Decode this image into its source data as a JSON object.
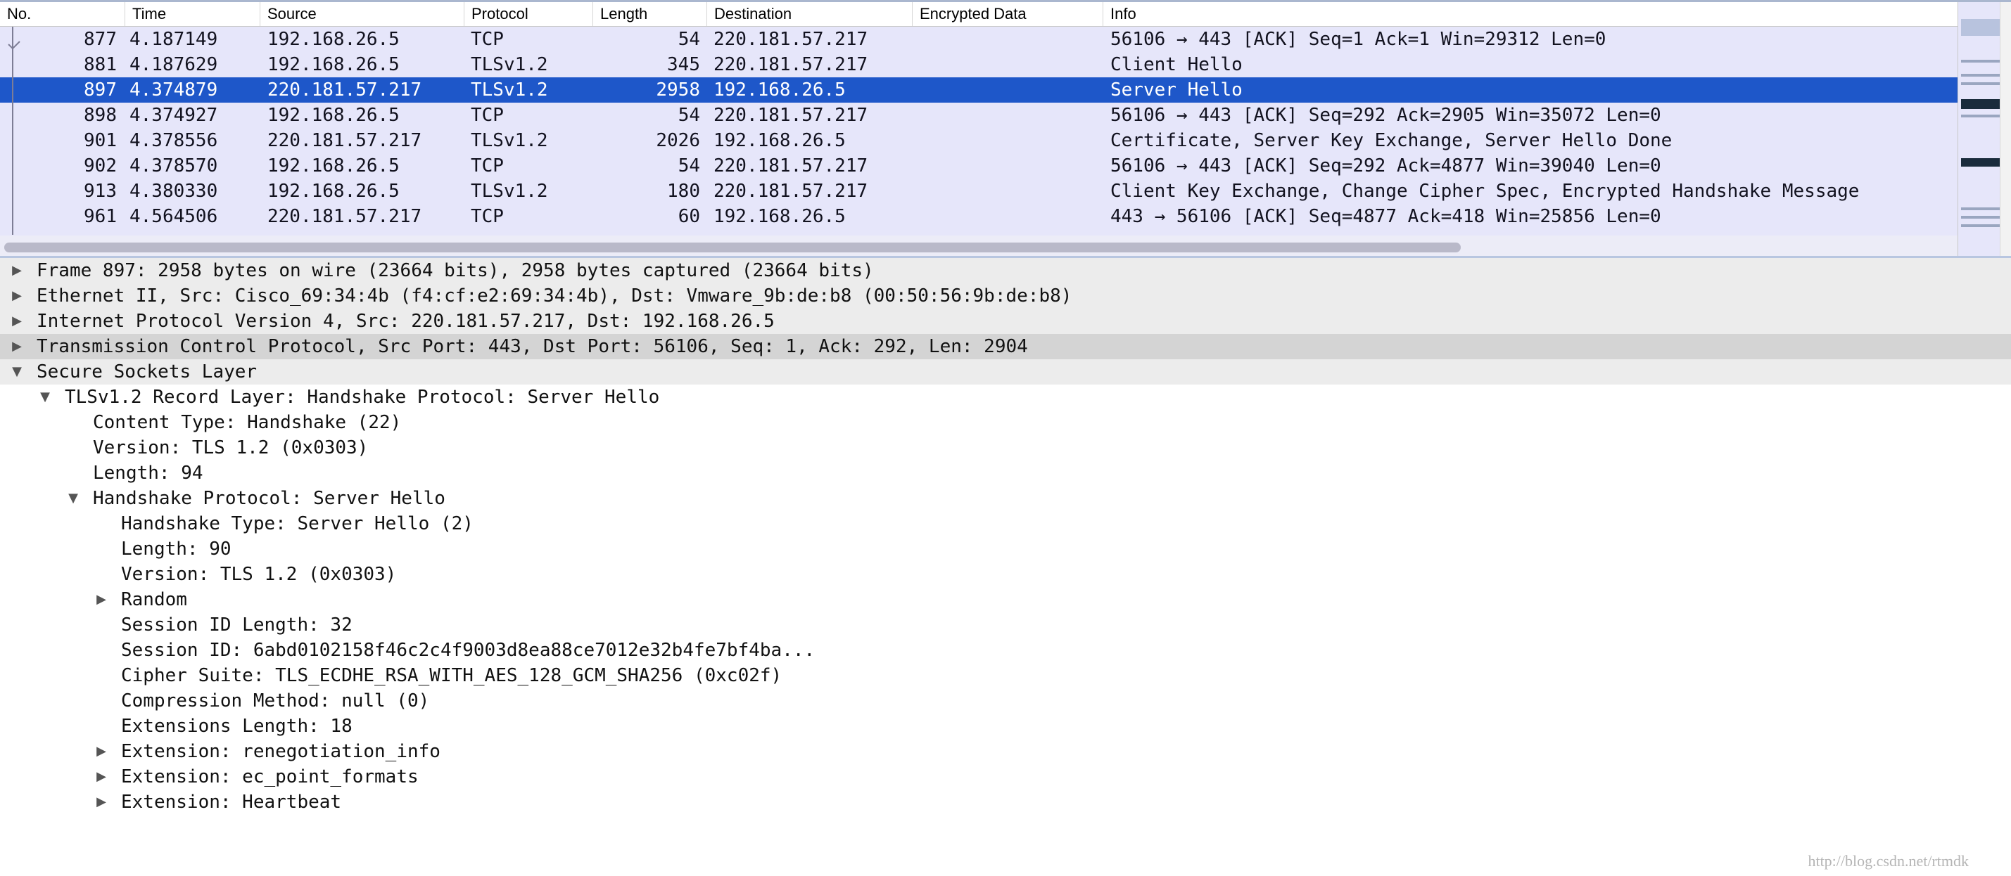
{
  "packet_list": {
    "columns": [
      "No.",
      "Time",
      "Source",
      "Protocol",
      "Length",
      "Destination",
      "Encrypted Data",
      "Info"
    ],
    "rows": [
      {
        "no": "877",
        "time": "4.187149",
        "source": "192.168.26.5",
        "protocol": "TCP",
        "length": "54",
        "destination": "220.181.57.217",
        "encrypted": "",
        "info": "56106 → 443 [ACK] Seq=1 Ack=1 Win=29312 Len=0",
        "selected": false
      },
      {
        "no": "881",
        "time": "4.187629",
        "source": "192.168.26.5",
        "protocol": "TLSv1.2",
        "length": "345",
        "destination": "220.181.57.217",
        "encrypted": "",
        "info": "Client Hello",
        "selected": false
      },
      {
        "no": "897",
        "time": "4.374879",
        "source": "220.181.57.217",
        "protocol": "TLSv1.2",
        "length": "2958",
        "destination": "192.168.26.5",
        "encrypted": "",
        "info": "Server Hello",
        "selected": true
      },
      {
        "no": "898",
        "time": "4.374927",
        "source": "192.168.26.5",
        "protocol": "TCP",
        "length": "54",
        "destination": "220.181.57.217",
        "encrypted": "",
        "info": "56106 → 443 [ACK] Seq=292 Ack=2905 Win=35072 Len=0",
        "selected": false
      },
      {
        "no": "901",
        "time": "4.378556",
        "source": "220.181.57.217",
        "protocol": "TLSv1.2",
        "length": "2026",
        "destination": "192.168.26.5",
        "encrypted": "",
        "info": "Certificate, Server Key Exchange, Server Hello Done",
        "selected": false
      },
      {
        "no": "902",
        "time": "4.378570",
        "source": "192.168.26.5",
        "protocol": "TCP",
        "length": "54",
        "destination": "220.181.57.217",
        "encrypted": "",
        "info": "56106 → 443 [ACK] Seq=292 Ack=4877 Win=39040 Len=0",
        "selected": false
      },
      {
        "no": "913",
        "time": "4.380330",
        "source": "192.168.26.5",
        "protocol": "TLSv1.2",
        "length": "180",
        "destination": "220.181.57.217",
        "encrypted": "",
        "info": "Client Key Exchange, Change Cipher Spec, Encrypted Handshake Message",
        "selected": false
      },
      {
        "no": "961",
        "time": "4.564506",
        "source": "220.181.57.217",
        "protocol": "TCP",
        "length": "60",
        "destination": "192.168.26.5",
        "encrypted": "",
        "info": "443 → 56106 [ACK] Seq=4877 Ack=418 Win=25856 Len=0",
        "selected": false
      }
    ]
  },
  "details": {
    "rows": [
      {
        "text": "Frame 897: 2958 bytes on wire (23664 bits), 2958 bytes captured (23664 bits)",
        "level": 0,
        "toggle": "collapsed",
        "style": "band"
      },
      {
        "text": "Ethernet II, Src: Cisco_69:34:4b (f4:cf:e2:69:34:4b), Dst: Vmware_9b:de:b8 (00:50:56:9b:de:b8)",
        "level": 0,
        "toggle": "collapsed",
        "style": "band"
      },
      {
        "text": "Internet Protocol Version 4, Src: 220.181.57.217, Dst: 192.168.26.5",
        "level": 0,
        "toggle": "collapsed",
        "style": "band"
      },
      {
        "text": "Transmission Control Protocol, Src Port: 443, Dst Port: 56106, Seq: 1, Ack: 292, Len: 2904",
        "level": 0,
        "toggle": "collapsed",
        "style": "hl"
      },
      {
        "text": "Secure Sockets Layer",
        "level": 0,
        "toggle": "expanded",
        "style": "band"
      },
      {
        "text": "TLSv1.2 Record Layer: Handshake Protocol: Server Hello",
        "level": 1,
        "toggle": "expanded",
        "style": ""
      },
      {
        "text": "Content Type: Handshake (22)",
        "level": 2,
        "toggle": "",
        "style": ""
      },
      {
        "text": "Version: TLS 1.2 (0x0303)",
        "level": 2,
        "toggle": "",
        "style": ""
      },
      {
        "text": "Length: 94",
        "level": 2,
        "toggle": "",
        "style": ""
      },
      {
        "text": "Handshake Protocol: Server Hello",
        "level": 2,
        "toggle": "expanded",
        "style": ""
      },
      {
        "text": "Handshake Type: Server Hello (2)",
        "level": 3,
        "toggle": "",
        "style": ""
      },
      {
        "text": "Length: 90",
        "level": 3,
        "toggle": "",
        "style": ""
      },
      {
        "text": "Version: TLS 1.2 (0x0303)",
        "level": 3,
        "toggle": "",
        "style": ""
      },
      {
        "text": "Random",
        "level": 3,
        "toggle": "collapsed",
        "style": ""
      },
      {
        "text": "Session ID Length: 32",
        "level": 3,
        "toggle": "",
        "style": ""
      },
      {
        "text": "Session ID: 6abd0102158f46c2c4f9003d8ea88ce7012e32b4fe7bf4ba...",
        "level": 3,
        "toggle": "",
        "style": ""
      },
      {
        "text": "Cipher Suite: TLS_ECDHE_RSA_WITH_AES_128_GCM_SHA256 (0xc02f)",
        "level": 3,
        "toggle": "",
        "style": ""
      },
      {
        "text": "Compression Method: null (0)",
        "level": 3,
        "toggle": "",
        "style": ""
      },
      {
        "text": "Extensions Length: 18",
        "level": 3,
        "toggle": "",
        "style": ""
      },
      {
        "text": "Extension: renegotiation_info",
        "level": 3,
        "toggle": "collapsed",
        "style": ""
      },
      {
        "text": "Extension: ec_point_formats",
        "level": 3,
        "toggle": "collapsed",
        "style": ""
      },
      {
        "text": "Extension: Heartbeat",
        "level": 3,
        "toggle": "collapsed",
        "style": ""
      }
    ]
  },
  "icons": {
    "collapsed": "triangle-right-icon",
    "expanded": "triangle-down-icon"
  },
  "colors": {
    "selection": "#1e57c9",
    "row_bg": "#e6e6fa",
    "band": "#ececec",
    "highlight": "#d4d4d4"
  },
  "watermark": "http://blog.csdn.net/rtmdk"
}
